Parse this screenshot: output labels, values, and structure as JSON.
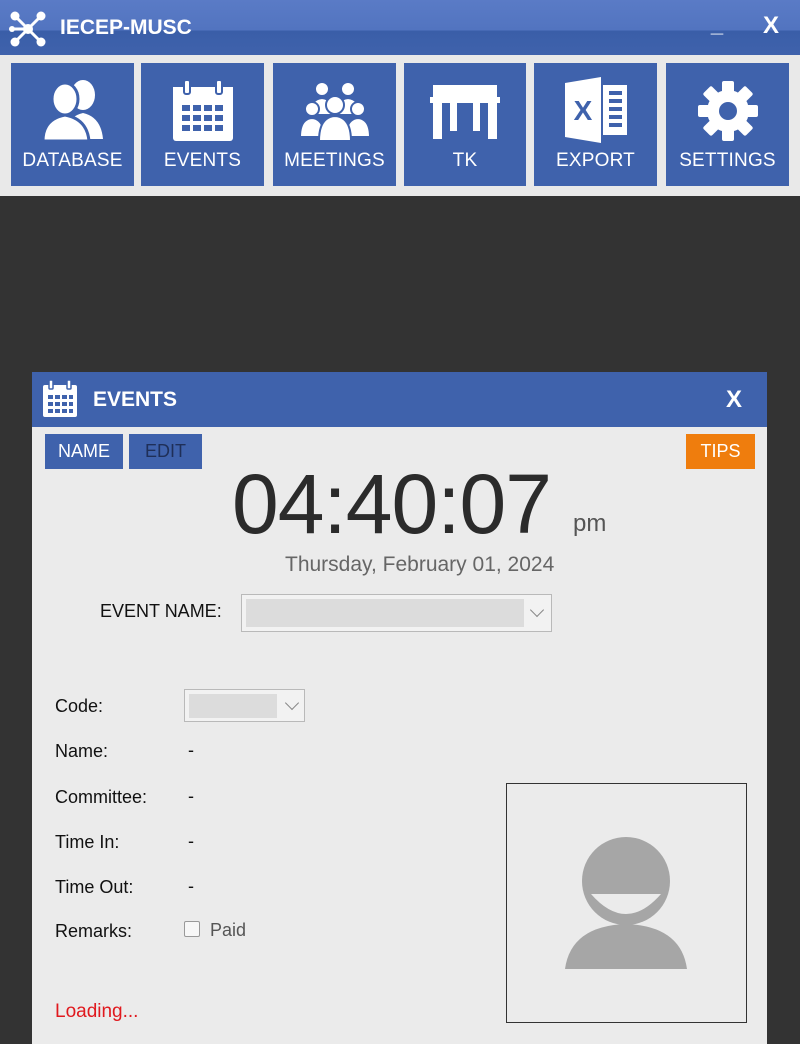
{
  "window": {
    "title": "IECEP-MUSC",
    "minimize_label": "_",
    "close_label": "X"
  },
  "toolbar": {
    "items": [
      {
        "label": "DATABASE",
        "icon": "users-icon"
      },
      {
        "label": "EVENTS",
        "icon": "calendar-icon"
      },
      {
        "label": "MEETINGS",
        "icon": "group-icon"
      },
      {
        "label": "TK",
        "icon": "table-icon"
      },
      {
        "label": "EXPORT",
        "icon": "excel-icon"
      },
      {
        "label": "SETTINGS",
        "icon": "gear-icon"
      }
    ]
  },
  "events_panel": {
    "title": "EVENTS",
    "close_label": "X",
    "buttons": {
      "name": "NAME",
      "edit": "EDIT",
      "tips": "TIPS"
    },
    "clock": {
      "time": "04:40:07",
      "ampm": "pm",
      "date": "Thursday, February 01, 2024"
    },
    "event_name_label": "EVENT NAME:",
    "event_name_value": "",
    "fields": {
      "code_label": "Code:",
      "code_value": "",
      "name_label": "Name:",
      "name_value": "-",
      "committee_label": "Committee:",
      "committee_value": "-",
      "time_in_label": "Time In:",
      "time_in_value": "-",
      "time_out_label": "Time Out:",
      "time_out_value": "-",
      "remarks_label": "Remarks:",
      "paid_label": "Paid",
      "paid_checked": false
    },
    "status": "Loading..."
  },
  "colors": {
    "primary": "#3f62ac",
    "tips": "#ef7d0d",
    "status": "#e0191e",
    "background": "#333333",
    "panel": "#ebebeb"
  }
}
